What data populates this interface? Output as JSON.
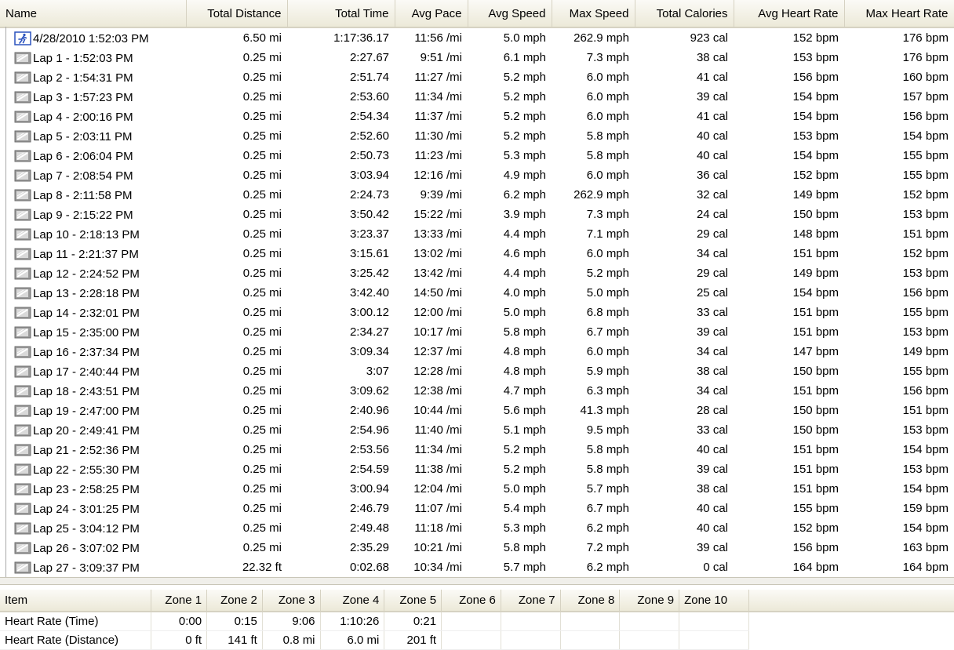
{
  "laps_table": {
    "columns": [
      "Name",
      "Total Distance",
      "Total Time",
      "Avg Pace",
      "Avg Speed",
      "Max Speed",
      "Total Calories",
      "Avg Heart Rate",
      "Max Heart Rate"
    ],
    "rows": [
      {
        "icon": "running-activity-icon",
        "cells": [
          "4/28/2010 1:52:03 PM",
          "6.50 mi",
          "1:17:36.17",
          "11:56 /mi",
          "5.0 mph",
          "262.9 mph",
          "923 cal",
          "152 bpm",
          "176 bpm"
        ]
      },
      {
        "icon": "lap-icon",
        "cells": [
          "Lap 1 - 1:52:03 PM",
          "0.25 mi",
          "2:27.67",
          "9:51 /mi",
          "6.1 mph",
          "7.3 mph",
          "38 cal",
          "153 bpm",
          "176 bpm"
        ]
      },
      {
        "icon": "lap-icon",
        "cells": [
          "Lap 2 - 1:54:31 PM",
          "0.25 mi",
          "2:51.74",
          "11:27 /mi",
          "5.2 mph",
          "6.0 mph",
          "41 cal",
          "156 bpm",
          "160 bpm"
        ]
      },
      {
        "icon": "lap-icon",
        "cells": [
          "Lap 3 - 1:57:23 PM",
          "0.25 mi",
          "2:53.60",
          "11:34 /mi",
          "5.2 mph",
          "6.0 mph",
          "39 cal",
          "154 bpm",
          "157 bpm"
        ]
      },
      {
        "icon": "lap-icon",
        "cells": [
          "Lap 4 - 2:00:16 PM",
          "0.25 mi",
          "2:54.34",
          "11:37 /mi",
          "5.2 mph",
          "6.0 mph",
          "41 cal",
          "154 bpm",
          "156 bpm"
        ]
      },
      {
        "icon": "lap-icon",
        "cells": [
          "Lap 5 - 2:03:11 PM",
          "0.25 mi",
          "2:52.60",
          "11:30 /mi",
          "5.2 mph",
          "5.8 mph",
          "40 cal",
          "153 bpm",
          "154 bpm"
        ]
      },
      {
        "icon": "lap-icon",
        "cells": [
          "Lap 6 - 2:06:04 PM",
          "0.25 mi",
          "2:50.73",
          "11:23 /mi",
          "5.3 mph",
          "5.8 mph",
          "40 cal",
          "154 bpm",
          "155 bpm"
        ]
      },
      {
        "icon": "lap-icon",
        "cells": [
          "Lap 7 - 2:08:54 PM",
          "0.25 mi",
          "3:03.94",
          "12:16 /mi",
          "4.9 mph",
          "6.0 mph",
          "36 cal",
          "152 bpm",
          "155 bpm"
        ]
      },
      {
        "icon": "lap-icon",
        "cells": [
          "Lap 8 - 2:11:58 PM",
          "0.25 mi",
          "2:24.73",
          "9:39 /mi",
          "6.2 mph",
          "262.9 mph",
          "32 cal",
          "149 bpm",
          "152 bpm"
        ]
      },
      {
        "icon": "lap-icon",
        "cells": [
          "Lap 9 - 2:15:22 PM",
          "0.25 mi",
          "3:50.42",
          "15:22 /mi",
          "3.9 mph",
          "7.3 mph",
          "24 cal",
          "150 bpm",
          "153 bpm"
        ]
      },
      {
        "icon": "lap-icon",
        "cells": [
          "Lap 10 - 2:18:13 PM",
          "0.25 mi",
          "3:23.37",
          "13:33 /mi",
          "4.4 mph",
          "7.1 mph",
          "29 cal",
          "148 bpm",
          "151 bpm"
        ]
      },
      {
        "icon": "lap-icon",
        "cells": [
          "Lap 11 - 2:21:37 PM",
          "0.25 mi",
          "3:15.61",
          "13:02 /mi",
          "4.6 mph",
          "6.0 mph",
          "34 cal",
          "151 bpm",
          "152 bpm"
        ]
      },
      {
        "icon": "lap-icon",
        "cells": [
          "Lap 12 - 2:24:52 PM",
          "0.25 mi",
          "3:25.42",
          "13:42 /mi",
          "4.4 mph",
          "5.2 mph",
          "29 cal",
          "149 bpm",
          "153 bpm"
        ]
      },
      {
        "icon": "lap-icon",
        "cells": [
          "Lap 13 - 2:28:18 PM",
          "0.25 mi",
          "3:42.40",
          "14:50 /mi",
          "4.0 mph",
          "5.0 mph",
          "25 cal",
          "154 bpm",
          "156 bpm"
        ]
      },
      {
        "icon": "lap-icon",
        "cells": [
          "Lap 14 - 2:32:01 PM",
          "0.25 mi",
          "3:00.12",
          "12:00 /mi",
          "5.0 mph",
          "6.8 mph",
          "33 cal",
          "151 bpm",
          "155 bpm"
        ]
      },
      {
        "icon": "lap-icon",
        "cells": [
          "Lap 15 - 2:35:00 PM",
          "0.25 mi",
          "2:34.27",
          "10:17 /mi",
          "5.8 mph",
          "6.7 mph",
          "39 cal",
          "151 bpm",
          "153 bpm"
        ]
      },
      {
        "icon": "lap-icon",
        "cells": [
          "Lap 16 - 2:37:34 PM",
          "0.25 mi",
          "3:09.34",
          "12:37 /mi",
          "4.8 mph",
          "6.0 mph",
          "34 cal",
          "147 bpm",
          "149 bpm"
        ]
      },
      {
        "icon": "lap-icon",
        "cells": [
          "Lap 17 - 2:40:44 PM",
          "0.25 mi",
          "3:07",
          "12:28 /mi",
          "4.8 mph",
          "5.9 mph",
          "38 cal",
          "150 bpm",
          "155 bpm"
        ]
      },
      {
        "icon": "lap-icon",
        "cells": [
          "Lap 18 - 2:43:51 PM",
          "0.25 mi",
          "3:09.62",
          "12:38 /mi",
          "4.7 mph",
          "6.3 mph",
          "34 cal",
          "151 bpm",
          "156 bpm"
        ]
      },
      {
        "icon": "lap-icon",
        "cells": [
          "Lap 19 - 2:47:00 PM",
          "0.25 mi",
          "2:40.96",
          "10:44 /mi",
          "5.6 mph",
          "41.3 mph",
          "28 cal",
          "150 bpm",
          "151 bpm"
        ]
      },
      {
        "icon": "lap-icon",
        "cells": [
          "Lap 20 - 2:49:41 PM",
          "0.25 mi",
          "2:54.96",
          "11:40 /mi",
          "5.1 mph",
          "9.5 mph",
          "33 cal",
          "150 bpm",
          "153 bpm"
        ]
      },
      {
        "icon": "lap-icon",
        "cells": [
          "Lap 21 - 2:52:36 PM",
          "0.25 mi",
          "2:53.56",
          "11:34 /mi",
          "5.2 mph",
          "5.8 mph",
          "40 cal",
          "151 bpm",
          "154 bpm"
        ]
      },
      {
        "icon": "lap-icon",
        "cells": [
          "Lap 22 - 2:55:30 PM",
          "0.25 mi",
          "2:54.59",
          "11:38 /mi",
          "5.2 mph",
          "5.8 mph",
          "39 cal",
          "151 bpm",
          "153 bpm"
        ]
      },
      {
        "icon": "lap-icon",
        "cells": [
          "Lap 23 - 2:58:25 PM",
          "0.25 mi",
          "3:00.94",
          "12:04 /mi",
          "5.0 mph",
          "5.7 mph",
          "38 cal",
          "151 bpm",
          "154 bpm"
        ]
      },
      {
        "icon": "lap-icon",
        "cells": [
          "Lap 24 - 3:01:25 PM",
          "0.25 mi",
          "2:46.79",
          "11:07 /mi",
          "5.4 mph",
          "6.7 mph",
          "40 cal",
          "155 bpm",
          "159 bpm"
        ]
      },
      {
        "icon": "lap-icon",
        "cells": [
          "Lap 25 - 3:04:12 PM",
          "0.25 mi",
          "2:49.48",
          "11:18 /mi",
          "5.3 mph",
          "6.2 mph",
          "40 cal",
          "152 bpm",
          "154 bpm"
        ]
      },
      {
        "icon": "lap-icon",
        "cells": [
          "Lap 26 - 3:07:02 PM",
          "0.25 mi",
          "2:35.29",
          "10:21 /mi",
          "5.8 mph",
          "7.2 mph",
          "39 cal",
          "156 bpm",
          "163 bpm"
        ]
      },
      {
        "icon": "lap-icon",
        "cells": [
          "Lap 27 - 3:09:37 PM",
          "22.32 ft",
          "0:02.68",
          "10:34 /mi",
          "5.7 mph",
          "6.2 mph",
          "0 cal",
          "164 bpm",
          "164 bpm"
        ]
      }
    ]
  },
  "zones_table": {
    "columns": [
      "Item",
      "Zone 1",
      "Zone 2",
      "Zone 3",
      "Zone 4",
      "Zone 5",
      "Zone 6",
      "Zone 7",
      "Zone 8",
      "Zone 9",
      "Zone 10"
    ],
    "rows": [
      {
        "cells": [
          "Heart Rate (Time)",
          "0:00",
          "0:15",
          "9:06",
          "1:10:26",
          "0:21",
          "",
          "",
          "",
          "",
          ""
        ]
      },
      {
        "cells": [
          "Heart Rate (Distance)",
          "0 ft",
          "141 ft",
          "0.8 mi",
          "6.0 mi",
          "201 ft",
          "",
          "",
          "",
          "",
          ""
        ]
      }
    ]
  }
}
